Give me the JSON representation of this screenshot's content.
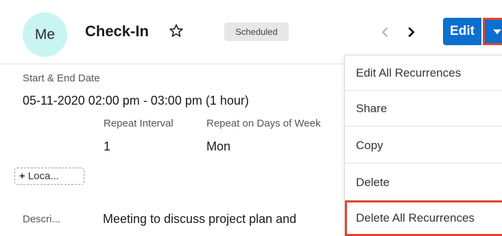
{
  "header": {
    "avatar_text": "Me",
    "title": "Check-In",
    "status": "Scheduled",
    "edit_label": "Edit"
  },
  "fields": {
    "date_label": "Start & End Date",
    "date_value": "05-11-2020 02:00 pm - 03:00 pm (1 hour)",
    "repeat_interval_label": "Repeat Interval",
    "repeat_interval_value": "1",
    "repeat_days_label": "Repeat on Days of Week",
    "repeat_days_value": "Mon",
    "location_label": "Loca...",
    "description_label": "Descri...",
    "description_value": "Meeting to discuss project plan and"
  },
  "menu": {
    "items": [
      {
        "label": "Edit All Recurrences"
      },
      {
        "label": "Share"
      },
      {
        "label": "Copy"
      },
      {
        "label": "Delete"
      },
      {
        "label": "Delete All Recurrences"
      }
    ]
  },
  "colors": {
    "accent": "#0b6fd0",
    "highlight": "#e5452c",
    "avatar_bg": "#c8f5f2"
  },
  "icons": {
    "favorite": "star-outline-icon",
    "prev": "chevron-left-icon",
    "next": "chevron-right-icon",
    "dropdown": "caret-down-icon",
    "add": "plus-icon"
  }
}
